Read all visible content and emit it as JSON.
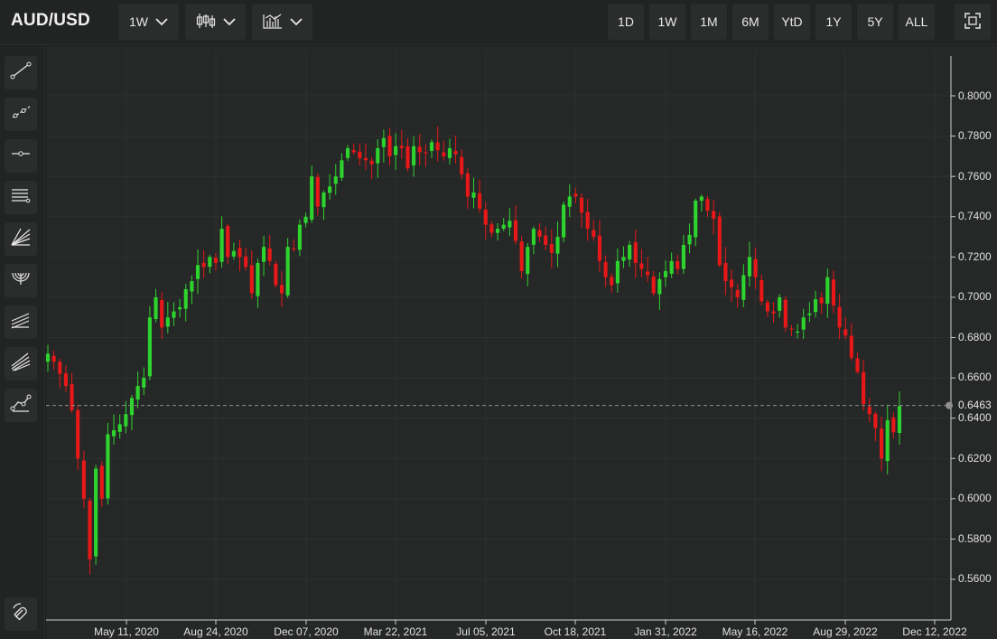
{
  "header": {
    "symbol": "AUD/USD",
    "interval": "1W",
    "chart_style_icon": "candlestick-icon",
    "indicators_icon": "indicator-chart-icon"
  },
  "ranges": [
    "1D",
    "1W",
    "1M",
    "6M",
    "YtD",
    "1Y",
    "5Y",
    "ALL"
  ],
  "toolbar_icons": [
    "trend-line-icon",
    "ray-line-icon",
    "horizontal-line-icon",
    "parallel-channel-icon",
    "fan-lines-icon",
    "arc-icon",
    "regression-channel-icon",
    "pitchfork-icon",
    "polyline-icon",
    "magnet-icon"
  ],
  "colors": {
    "up": "#2ed42e",
    "down": "#e81818",
    "background": "#262727",
    "grid": "#2f3030",
    "current_line": "#8a8a8a"
  },
  "current_price": "0.6463",
  "chart_data": {
    "type": "candlestick",
    "interval": "1W",
    "ylim": [
      0.545,
      0.822
    ],
    "y_ticks": [
      "0.5600",
      "0.5800",
      "0.6000",
      "0.6200",
      "0.6400",
      "0.6600",
      "0.6800",
      "0.7000",
      "0.7200",
      "0.7400",
      "0.7600",
      "0.7800",
      "0.8000"
    ],
    "x_ticks": [
      "May 11, 2020",
      "Aug 24, 2020",
      "Dec 07, 2020",
      "Mar 22, 2021",
      "Jul 05, 2021",
      "Oct 18, 2021",
      "Jan 31, 2022",
      "May 16, 2022",
      "Aug 29, 2022",
      "Dec 12, 2022"
    ],
    "grid": true,
    "current_price": 0.6463,
    "closes": [
      0.672,
      0.668,
      0.662,
      0.656,
      0.644,
      0.62,
      0.6,
      0.57,
      0.615,
      0.6,
      0.632,
      0.634,
      0.637,
      0.642,
      0.65,
      0.656,
      0.66,
      0.69,
      0.7,
      0.685,
      0.69,
      0.693,
      0.695,
      0.704,
      0.708,
      0.716,
      0.715,
      0.72,
      0.717,
      0.734,
      0.72,
      0.723,
      0.72,
      0.715,
      0.702,
      0.717,
      0.725,
      0.718,
      0.706,
      0.702,
      0.725,
      0.724,
      0.736,
      0.74,
      0.76,
      0.745,
      0.752,
      0.755,
      0.76,
      0.768,
      0.774,
      0.772,
      0.769,
      0.768,
      0.766,
      0.774,
      0.779,
      0.77,
      0.775,
      0.774,
      0.764,
      0.775,
      0.772,
      0.772,
      0.777,
      0.773,
      0.77,
      0.774,
      0.771,
      0.761,
      0.75,
      0.752,
      0.744,
      0.736,
      0.732,
      0.734,
      0.736,
      0.738,
      0.728,
      0.713,
      0.725,
      0.734,
      0.73,
      0.726,
      0.722,
      0.73,
      0.746,
      0.75,
      0.75,
      0.742,
      0.734,
      0.73,
      0.718,
      0.71,
      0.706,
      0.718,
      0.72,
      0.726,
      0.717,
      0.714,
      0.711,
      0.702,
      0.709,
      0.713,
      0.718,
      0.714,
      0.726,
      0.731,
      0.748,
      0.75,
      0.743,
      0.739,
      0.716,
      0.708,
      0.705,
      0.7,
      0.711,
      0.72,
      0.71,
      0.698,
      0.693,
      0.692,
      0.7,
      0.685,
      0.684,
      0.683,
      0.69,
      0.692,
      0.699,
      0.697,
      0.71,
      0.696,
      0.685,
      0.681,
      0.67,
      0.663,
      0.647,
      0.642,
      0.635,
      0.62,
      0.639,
      0.633,
      0.646
    ]
  }
}
